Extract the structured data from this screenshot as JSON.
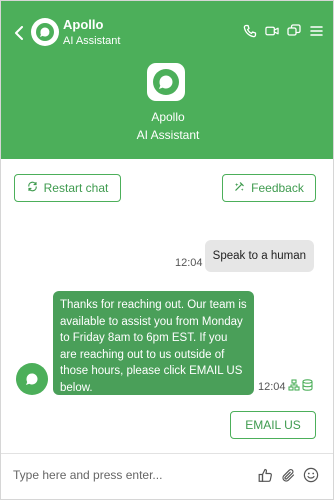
{
  "header": {
    "name": "Apollo",
    "subtitle": "AI Assistant",
    "icons": [
      "back-chevron-icon",
      "phone-icon",
      "video-icon",
      "chat-bubbles-icon",
      "menu-icon"
    ]
  },
  "profile": {
    "name": "Apollo",
    "subtitle": "AI Assistant"
  },
  "actions": {
    "restart_label": "Restart chat",
    "feedback_label": "Feedback"
  },
  "messages": {
    "user": {
      "text": "Speak to a human",
      "time": "12:04"
    },
    "bot": {
      "text": "Thanks for reaching out. Our team is available to assist you from Monday to Friday 8am to 6pm EST. If you are reaching out to us outside of those hours, please click EMAIL US below.",
      "time": "12:04",
      "email_button": "EMAIL US"
    }
  },
  "composer": {
    "placeholder": "Type here and press enter..."
  },
  "colors": {
    "brand": "#4caf5a",
    "bot_bubble": "#4a9f59",
    "user_bubble": "#e6e6e6"
  }
}
